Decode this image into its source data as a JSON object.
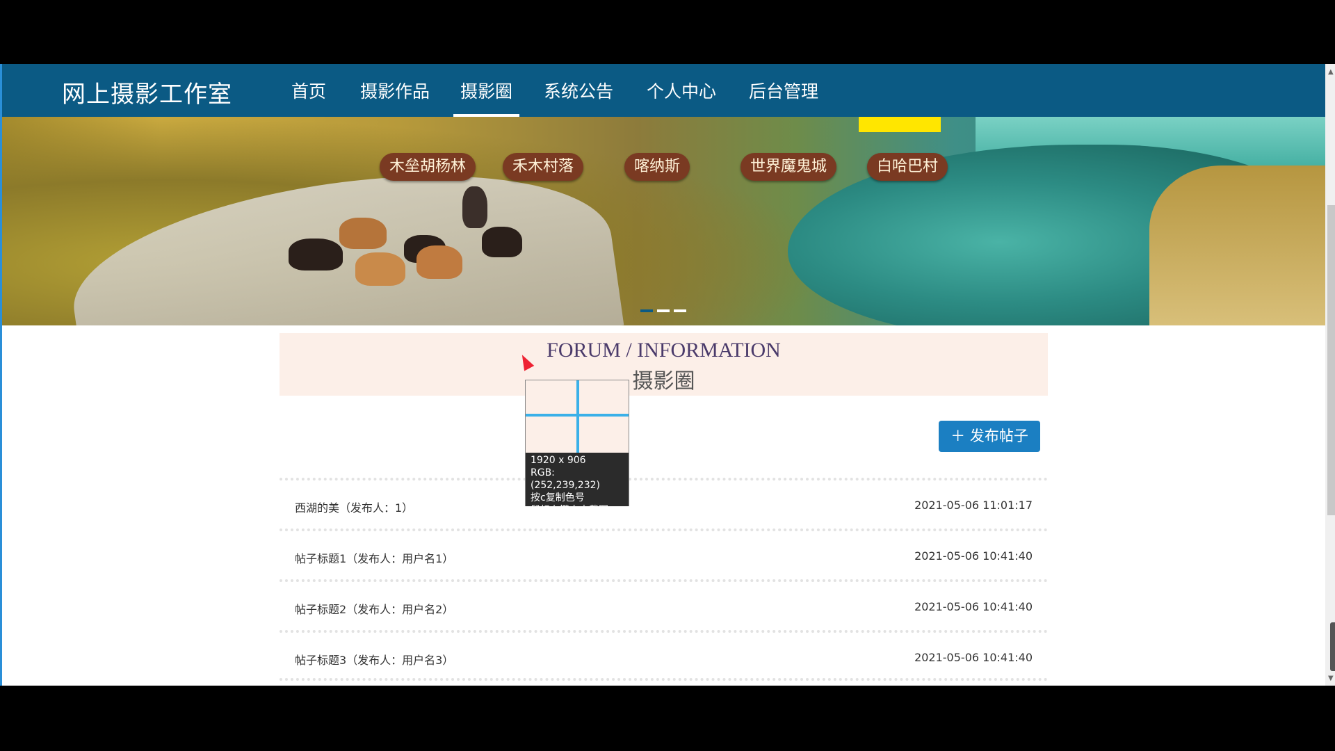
{
  "nav": {
    "brand": "网上摄影工作室",
    "items": [
      "首页",
      "摄影作品",
      "摄影圈",
      "系统公告",
      "个人中心",
      "后台管理"
    ]
  },
  "banner": {
    "signs": [
      "木垒胡杨林",
      "禾木村落",
      "喀纳斯",
      "世界魔鬼城",
      "白哈巴村"
    ]
  },
  "forum": {
    "title": "FORUM / INFORMATION",
    "subtitle": "摄影圈",
    "publish_label": "＋ 发布帖子",
    "posts": [
      {
        "title": "西湖的美（发布人：1）",
        "date": "2021-05-06 11:01:17"
      },
      {
        "title": "帖子标题1（发布人：用户名1）",
        "date": "2021-05-06 10:41:40"
      },
      {
        "title": "帖子标题2（发布人：用户名2）",
        "date": "2021-05-06 10:41:40"
      },
      {
        "title": "帖子标题3（发布人：用户名3）",
        "date": "2021-05-06 10:41:40"
      }
    ]
  },
  "picker": {
    "size": "1920 x 906",
    "rgb": "RGB:(252,239,232)",
    "copy_hint": "按c复制色号",
    "capture_hint": "鼠标右键自由截图"
  },
  "colors": {
    "nav_bg": "#0b5a84",
    "forum_bg": "#fcefe8",
    "button_bg": "#1b7fc2"
  }
}
